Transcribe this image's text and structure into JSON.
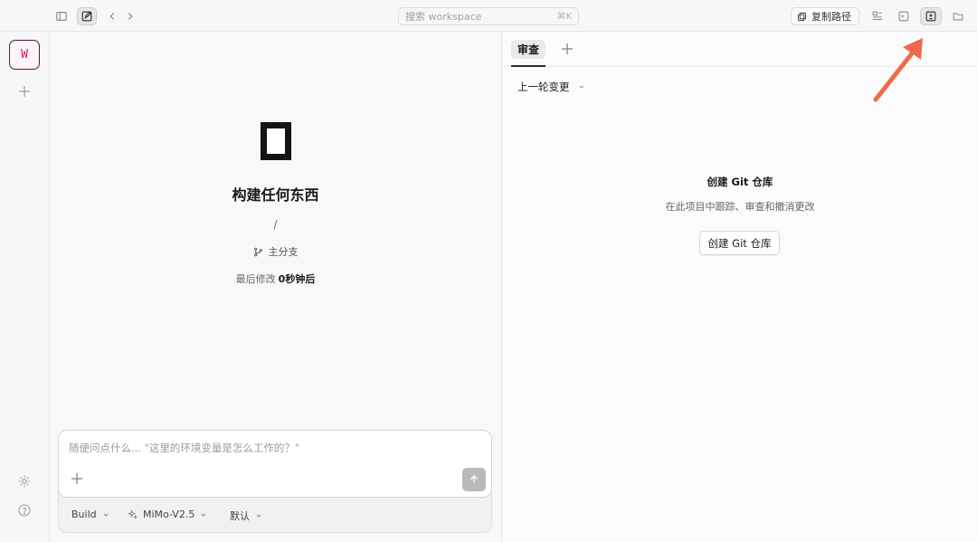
{
  "topbar": {
    "search": {
      "placeholder": "搜索 workspace",
      "shortcut": "⌘K"
    },
    "copy_path_label": "复制路径"
  },
  "rail": {
    "workspace_initial": "W"
  },
  "left": {
    "title": "构建任何东西",
    "path": "/",
    "branch_label": "主分支",
    "modified_prefix": "最后修改",
    "modified_value": "0秒钟后",
    "composer": {
      "placeholder": "随便问点什么... \"这里的环境变量是怎么工作的？\""
    },
    "options": {
      "mode": "Build",
      "model": "MiMo-V2.5",
      "variant": "默认"
    }
  },
  "right": {
    "tab_review": "审查",
    "round_select": "上一轮变更",
    "git_title": "创建 Git 仓库",
    "git_desc": "在此项目中跟踪、审查和撤消更改",
    "git_button": "创建 Git 仓库"
  },
  "colors": {
    "accent_arrow": "#ee6a4c",
    "avatar_border": "#4a1f3d",
    "avatar_text": "#c2185b"
  }
}
